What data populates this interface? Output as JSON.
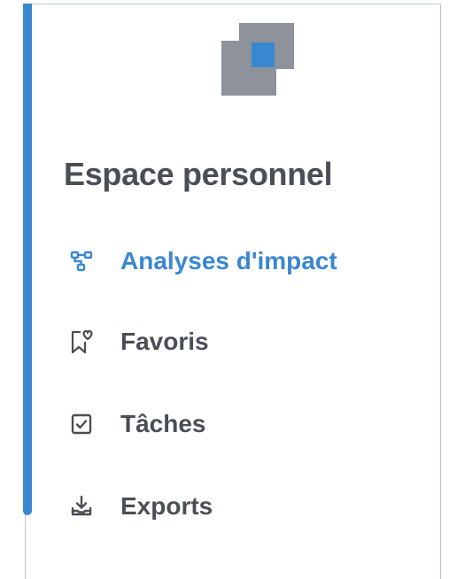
{
  "sidebar": {
    "title": "Espace personnel",
    "accent_color": "#3a87d2",
    "logo_colors": {
      "gray": "#8e929a",
      "blue": "#3a87d2"
    },
    "items": [
      {
        "label": "Analyses d'impact",
        "icon": "flowchart-icon",
        "active": true
      },
      {
        "label": "Favoris",
        "icon": "bookmark-heart-icon",
        "active": false
      },
      {
        "label": "Tâches",
        "icon": "checkbox-icon",
        "active": false
      },
      {
        "label": "Exports",
        "icon": "download-tray-icon",
        "active": false
      }
    ]
  }
}
